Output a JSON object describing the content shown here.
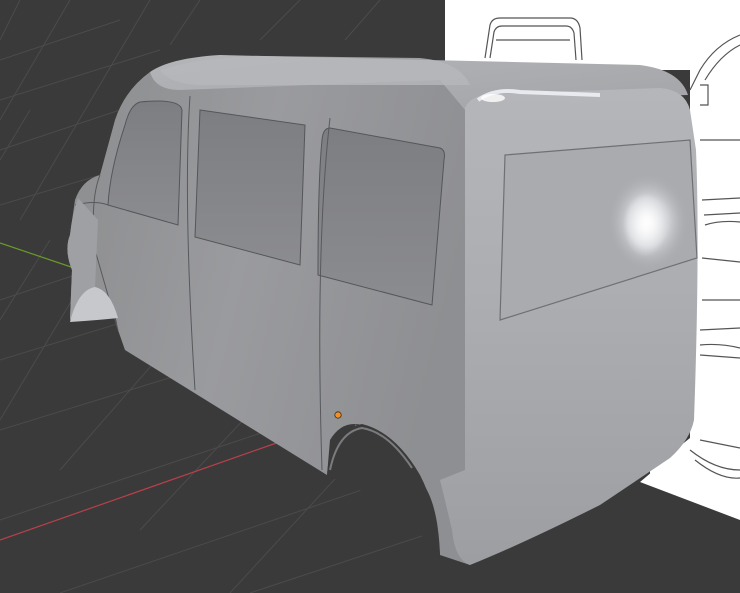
{
  "viewport": {
    "background_color": "#3a3a3a",
    "grid_color": "#4a4a4a",
    "axis_x_color": "#b8404a",
    "axis_y_color": "#6a9a2a",
    "reference_image_color": "#ffffff",
    "model_color": "#a7a9ac",
    "origin_marker_color": "#f0902a"
  },
  "icons": {
    "origin": "origin-point-icon"
  }
}
